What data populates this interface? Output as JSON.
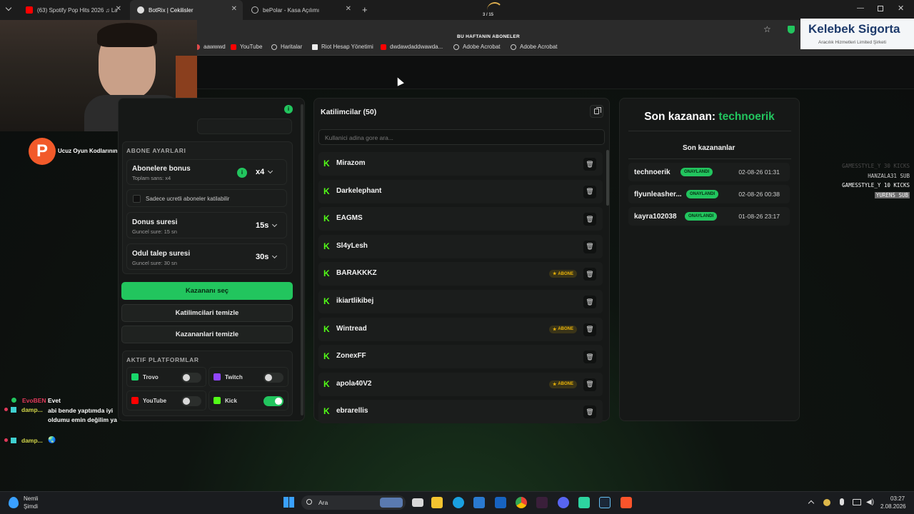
{
  "browser": {
    "tabs": [
      {
        "label": "(63) Spotify Pop Hits 2026 ♫ La",
        "active": false
      },
      {
        "label": "BotRix | Cekilisler",
        "active": true
      },
      {
        "label": "bePolar - Kasa Açılımı",
        "active": false
      }
    ],
    "new_tab": "+",
    "loading_counter": "3 / 15",
    "page_header": "BU HAFTANIN ABONELER",
    "bookmarks": [
      "aawwwd",
      "YouTube",
      "Haritalar",
      "Riot Hesap Yönetimi",
      "dwdawdaddwawda...",
      "Adobe Acrobat",
      "Adobe Acrobat"
    ]
  },
  "sponsor": {
    "title": "Kelebek Sigorta",
    "subtitle": "Aracılık Hizmetleri Limited Şirketi"
  },
  "stream_overlay": {
    "logo_text": "Ucuz Oyun Kodlarının Adresi",
    "chat": [
      {
        "user": "EvoBEN",
        "message": "Evet"
      },
      {
        "user": "damp...",
        "message": "abi bende yaptımda iyi oldumu emin değilim ya"
      },
      {
        "user": "damp...",
        "message": "🌏"
      }
    ],
    "event_feed": [
      {
        "text": "GAMESSTYLE_Y 30 KICKS"
      },
      {
        "text": "HANZALA31 SUB"
      },
      {
        "text": "GAMESSTYLE_Y 10 KICKS"
      },
      {
        "text": "YURENS SUB"
      }
    ]
  },
  "settings": {
    "section_title": "ABONE AYARLARI",
    "sub_bonus": {
      "title": "Abonelere bonus",
      "sub": "Toplam sans: x4",
      "value": "x4"
    },
    "paid_only": {
      "label": "Sadece ucretli aboneler katilabilir",
      "checked": false
    },
    "bonus_time": {
      "title": "Donus suresi",
      "sub": "Guncel sure: 15 sn",
      "value": "15s"
    },
    "claim_time": {
      "title": "Odul talep suresi",
      "sub": "Guncel sure: 30 sn",
      "value": "30s"
    },
    "buttons": {
      "pick": "Kazananı seç",
      "clear_participants": "Katilimcilari temizle",
      "clear_winners": "Kazananlari temizle"
    },
    "platforms_title": "AKTIF PLATFORMLAR",
    "platforms": [
      {
        "name": "Trovo",
        "enabled": false,
        "color": "#19d66b"
      },
      {
        "name": "Twitch",
        "enabled": false,
        "color": "#9146ff"
      },
      {
        "name": "YouTube",
        "enabled": false,
        "color": "#ff0000"
      },
      {
        "name": "Kick",
        "enabled": true,
        "color": "#53fc18"
      }
    ]
  },
  "participants": {
    "title": "Katilimcilar (50)",
    "search_placeholder": "Kullanici adina gore ara...",
    "badge_label": "ABONE",
    "list": [
      {
        "name": "Mirazom",
        "subscriber": false
      },
      {
        "name": "Darkelephant",
        "subscriber": false
      },
      {
        "name": "EAGMS",
        "subscriber": false
      },
      {
        "name": "Sl4yLesh",
        "subscriber": false
      },
      {
        "name": "BARAKKKZ",
        "subscriber": true
      },
      {
        "name": "ikiartlikibej",
        "subscriber": false
      },
      {
        "name": "Wintread",
        "subscriber": true
      },
      {
        "name": "ZonexFF",
        "subscriber": false
      },
      {
        "name": "apola40V2",
        "subscriber": true
      },
      {
        "name": "ebrarellis",
        "subscriber": false
      }
    ]
  },
  "winners": {
    "last_label": "Son kazanan:",
    "last_name": "technoerik",
    "list_title": "Son kazananlar",
    "status_label": "ONAYLANDI",
    "list": [
      {
        "name": "technoerik",
        "date": "02-08-26 01:31"
      },
      {
        "name": "flyunleasher...",
        "date": "02-08-26 00:38"
      },
      {
        "name": "kayra102038",
        "date": "01-08-26 23:17"
      }
    ]
  },
  "taskbar": {
    "weather_label": "Nemli",
    "weather_sub": "Şimdi",
    "search_label": "Ara",
    "time": "03:27",
    "date": "2.08.2026"
  },
  "colors": {
    "accent": "#22c55e",
    "kick": "#53fc18",
    "sub_badge": "#eab308"
  }
}
